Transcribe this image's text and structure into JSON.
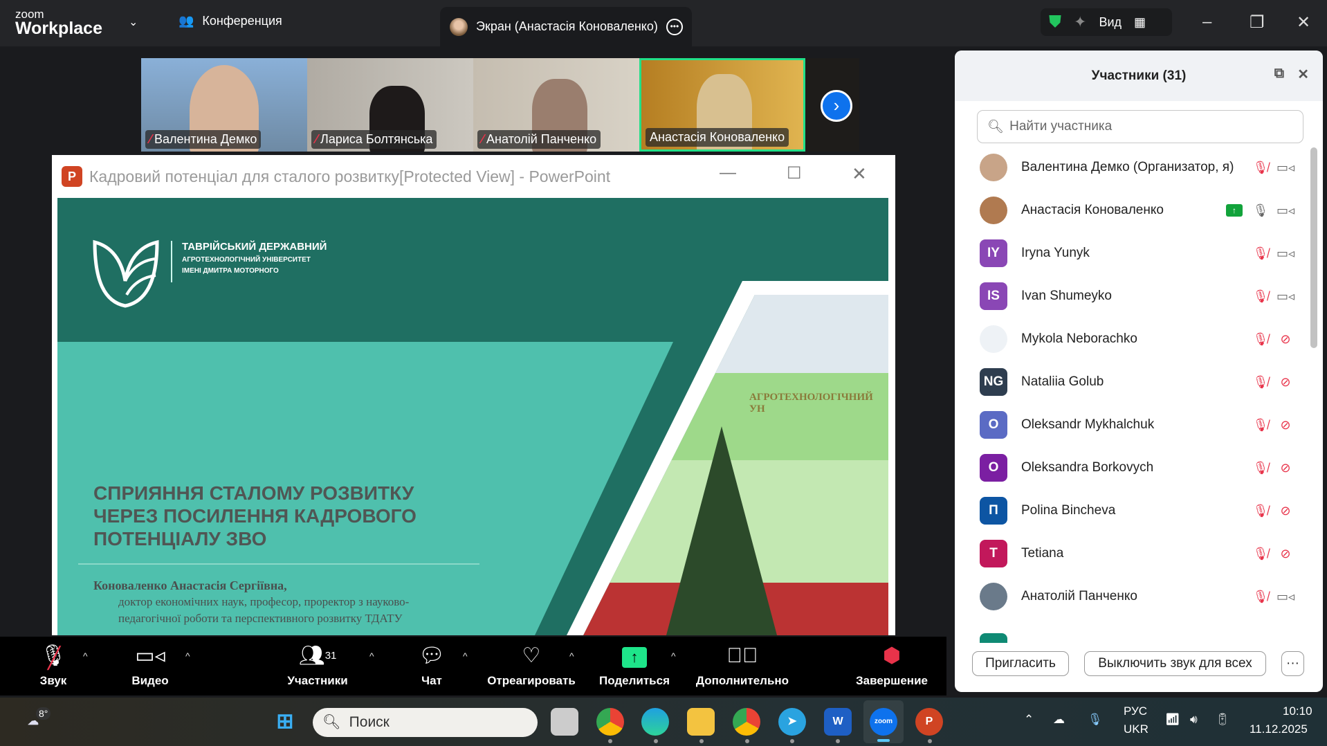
{
  "app": {
    "logo_top": "zoom",
    "logo_bottom": "Workplace",
    "meeting_label": "Конференция",
    "screen_tab": "Экран (Анастасія Коноваленко)",
    "view_label": "Вид"
  },
  "thumbnails": [
    {
      "name": "Валентина Демко",
      "muted": true,
      "bg": "#8aa7c8"
    },
    {
      "name": "Лариса Болтянська",
      "muted": true,
      "bg": "#b9b4ac"
    },
    {
      "name": "Анатолій Панченко",
      "muted": true,
      "bg": "#c9c2b4"
    },
    {
      "name": "Анастасія Коноваленко",
      "muted": false,
      "bg": "#c89a3a"
    }
  ],
  "ppt": {
    "title": "Кадровий потенціал для сталого розвитку[Protected View] - PowerPoint"
  },
  "slide": {
    "uni1": "ТАВРІЙСЬКИЙ ДЕРЖАВНИЙ",
    "uni2": "АГРОТЕХНОЛОГІЧНИЙ УНІВЕРСИТЕТ",
    "uni3": "ІМЕНІ ДМИТРА МОТОРНОГО",
    "title1": "СПРИЯННЯ СТАЛОМУ РОЗВИТКУ",
    "title2": "ЧЕРЕЗ ПОСИЛЕННЯ КАДРОВОГО",
    "title3": "ПОТЕНЦІАЛУ ЗВО",
    "author": "Коноваленко Анастасія Сергіївна,",
    "role1": "доктор економічних наук, професор, проректор з науково-",
    "role2": "педагогічної роботи та перспективного розвитку ТДАТУ",
    "building_sign": "АГРОТЕХНОЛОГІЧНИЙ УН"
  },
  "participants": {
    "title": "Участники (31)",
    "search_placeholder": "Найти участника",
    "list": [
      {
        "name": "Валентина Демко (Организатор, я)",
        "initials": "",
        "color": "#c8a488",
        "mic": "muted",
        "cam": "on"
      },
      {
        "name": "Анастасія Коноваленко",
        "initials": "",
        "color": "#b07a50",
        "mic": "on",
        "cam": "on",
        "sharing": true
      },
      {
        "name": "Iryna Yunyk",
        "initials": "IY",
        "color": "#8a47b5",
        "mic": "muted",
        "cam": "on"
      },
      {
        "name": "Ivan Shumeyko",
        "initials": "IS",
        "color": "#8a47b5",
        "mic": "muted",
        "cam": "on"
      },
      {
        "name": "Mykola Neborachko",
        "initials": "",
        "color": "#eef2f6",
        "mic": "muted",
        "cam": "off"
      },
      {
        "name": "Nataliia Golub",
        "initials": "NG",
        "color": "#2e3d4f",
        "mic": "muted",
        "cam": "off"
      },
      {
        "name": "Oleksandr Mykhalchuk",
        "initials": "O",
        "color": "#5b6bc4",
        "mic": "muted",
        "cam": "off"
      },
      {
        "name": "Oleksandra Borkovych",
        "initials": "O",
        "color": "#7b1fa2",
        "mic": "muted",
        "cam": "off"
      },
      {
        "name": "Polina Bincheva",
        "initials": "П",
        "color": "#0d55a3",
        "mic": "muted",
        "cam": "off"
      },
      {
        "name": "Tetiana",
        "initials": "T",
        "color": "#c2185b",
        "mic": "muted",
        "cam": "off"
      },
      {
        "name": "Анатолій Панченко",
        "initials": "",
        "color": "#6a7a8a",
        "mic": "muted",
        "cam": "on"
      }
    ],
    "invite": "Пригласить",
    "mute_all": "Выключить звук для всех",
    "more": "···"
  },
  "toolbar": {
    "audio": "Звук",
    "video": "Видео",
    "participants": "Участники",
    "participants_count": "31",
    "chat": "Чат",
    "react": "Отреагировать",
    "share": "Поделиться",
    "more": "Дополнительно",
    "end": "Завершение"
  },
  "taskbar": {
    "weather": "8°",
    "search": "Поиск",
    "lang1": "РУС",
    "lang2": "UKR",
    "time": "10:10",
    "date": "11.12.2025"
  }
}
